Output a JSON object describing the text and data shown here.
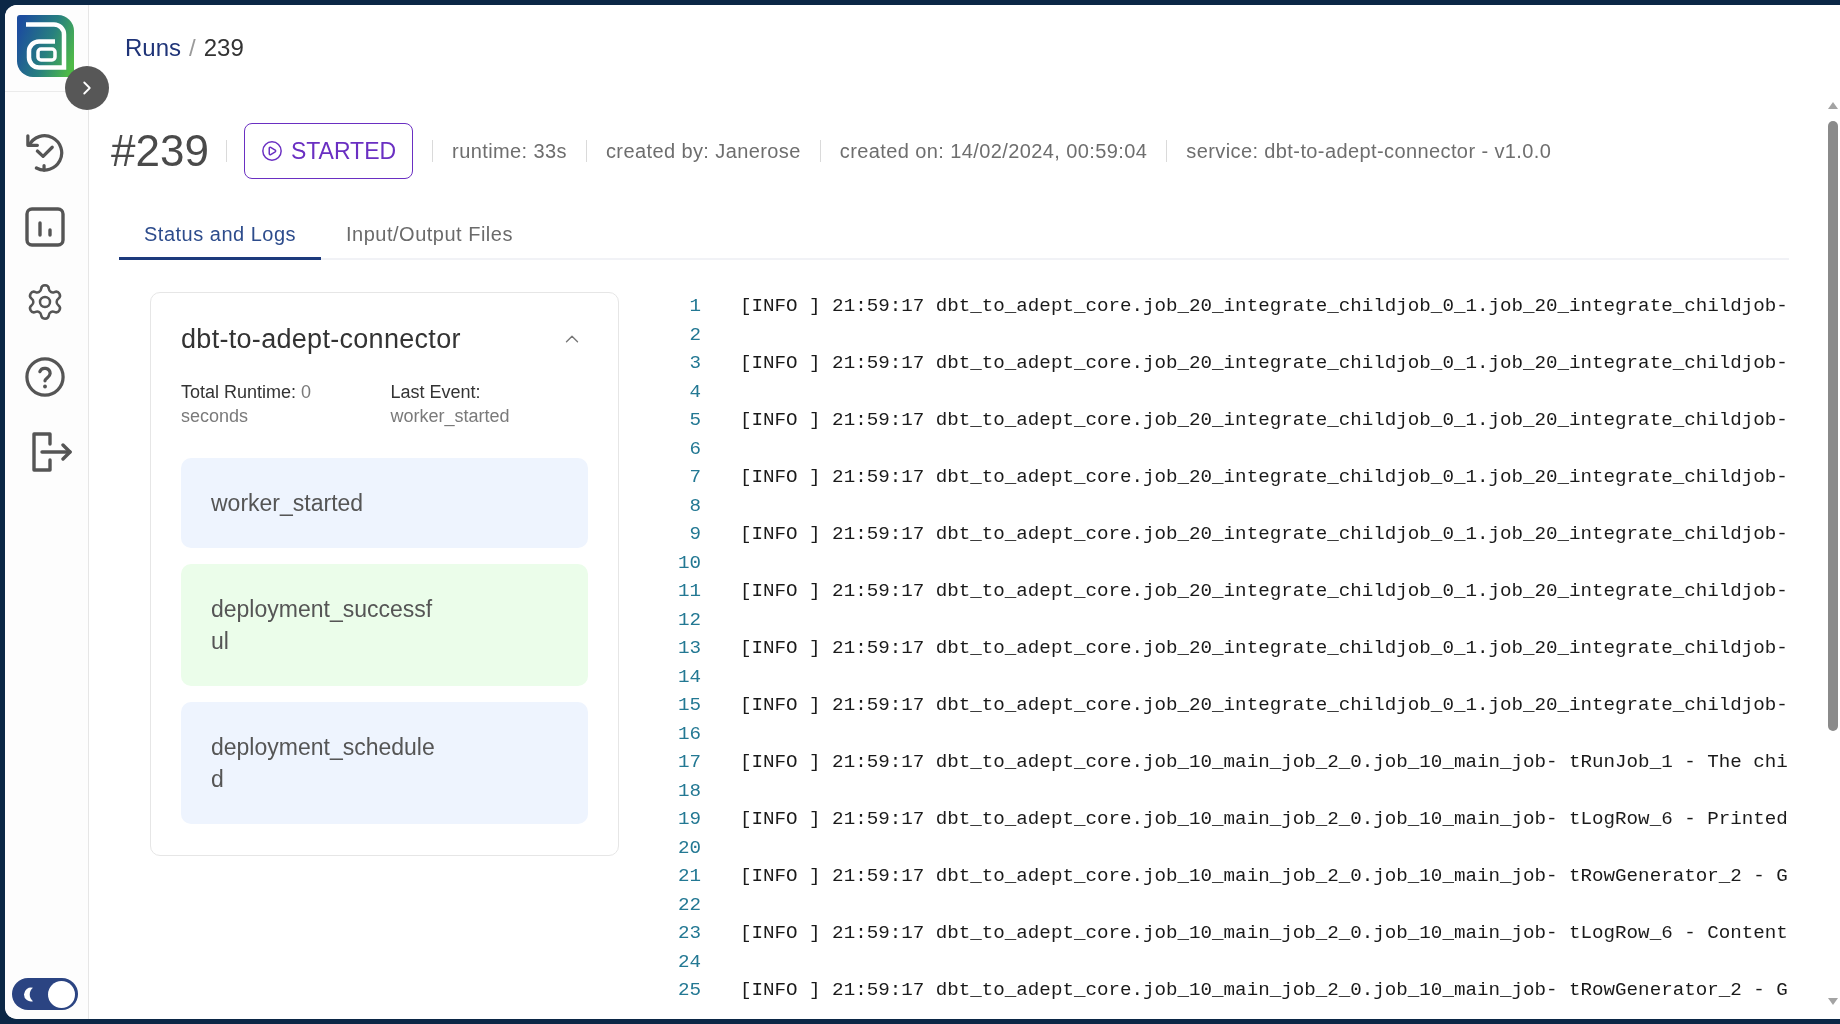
{
  "breadcrumb": {
    "separator": "/",
    "items": [
      {
        "label": "Runs",
        "kind": "link"
      },
      {
        "label": "239",
        "kind": "current"
      }
    ]
  },
  "run": {
    "number": "#239",
    "status": {
      "label": "STARTED",
      "kind": "started"
    },
    "meta": [
      "runtime: 33s",
      "created by: Janerose",
      "created on: 14/02/2024, 00:59:04",
      "service: dbt-to-adept-connector - v1.0.0"
    ]
  },
  "tabs": [
    {
      "label": "Status and Logs",
      "selected": true
    },
    {
      "label": "Input/Output Files",
      "selected": false
    }
  ],
  "worker_card": {
    "title": "dbt-to-adept-connector",
    "expanded": true,
    "stats": [
      {
        "label": "Total Runtime:",
        "value": "0 seconds"
      },
      {
        "label": "Last Event:",
        "value": "worker_started"
      }
    ],
    "events": [
      {
        "label": "worker_started",
        "color": "#eef4fe"
      },
      {
        "label": "deployment_successful",
        "color": "#ebfdea"
      },
      {
        "label": "deployment_scheduled",
        "color": "#eef4fe"
      }
    ]
  },
  "log_lines": [
    {
      "number": "1",
      "text": "[INFO ] 21:59:17 dbt_to_adept_core.job_20_integrate_childjob_0_1.job_20_integrate_childjob-"
    },
    {
      "number": "2"
    },
    {
      "number": "3",
      "text": "[INFO ] 21:59:17 dbt_to_adept_core.job_20_integrate_childjob_0_1.job_20_integrate_childjob-"
    },
    {
      "number": "4"
    },
    {
      "number": "5",
      "text": "[INFO ] 21:59:17 dbt_to_adept_core.job_20_integrate_childjob_0_1.job_20_integrate_childjob-"
    },
    {
      "number": "6"
    },
    {
      "number": "7",
      "text": "[INFO ] 21:59:17 dbt_to_adept_core.job_20_integrate_childjob_0_1.job_20_integrate_childjob-"
    },
    {
      "number": "8"
    },
    {
      "number": "9",
      "text": "[INFO ] 21:59:17 dbt_to_adept_core.job_20_integrate_childjob_0_1.job_20_integrate_childjob-"
    },
    {
      "number": "10"
    },
    {
      "number": "11",
      "text": "[INFO ] 21:59:17 dbt_to_adept_core.job_20_integrate_childjob_0_1.job_20_integrate_childjob-"
    },
    {
      "number": "12"
    },
    {
      "number": "13",
      "text": "[INFO ] 21:59:17 dbt_to_adept_core.job_20_integrate_childjob_0_1.job_20_integrate_childjob-"
    },
    {
      "number": "14"
    },
    {
      "number": "15",
      "text": "[INFO ] 21:59:17 dbt_to_adept_core.job_20_integrate_childjob_0_1.job_20_integrate_childjob-"
    },
    {
      "number": "16"
    },
    {
      "number": "17",
      "text": "[INFO ] 21:59:17 dbt_to_adept_core.job_10_main_job_2_0.job_10_main_job- tRunJob_1 - The chi"
    },
    {
      "number": "18"
    },
    {
      "number": "19",
      "text": "[INFO ] 21:59:17 dbt_to_adept_core.job_10_main_job_2_0.job_10_main_job- tLogRow_6 - Printed"
    },
    {
      "number": "20"
    },
    {
      "number": "21",
      "text": "[INFO ] 21:59:17 dbt_to_adept_core.job_10_main_job_2_0.job_10_main_job- tRowGenerator_2 - G"
    },
    {
      "number": "22"
    },
    {
      "number": "23",
      "text": "[INFO ] 21:59:17 dbt_to_adept_core.job_10_main_job_2_0.job_10_main_job- tLogRow_6 - Content"
    },
    {
      "number": "24"
    },
    {
      "number": "25",
      "text": "[INFO ] 21:59:17 dbt_to_adept_core.job_10_main_job_2_0.job_10_main_job- tRowGenerator_2 - G"
    }
  ],
  "theme_toggle": {
    "on": true
  }
}
